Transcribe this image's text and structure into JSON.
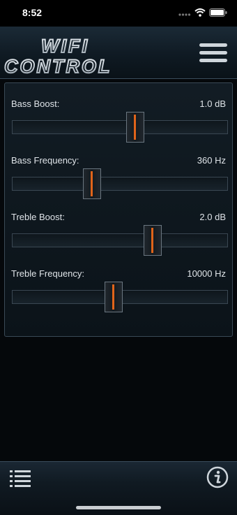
{
  "status_bar": {
    "time": "8:52"
  },
  "header": {
    "logo_line1": "WIFI",
    "logo_line2": "CONTROL",
    "menu_icon": "hamburger-menu-icon"
  },
  "sliders": [
    {
      "label": "Bass Boost:",
      "value": "1.0 dB",
      "level": 0.57
    },
    {
      "label": "Bass Frequency:",
      "value": "360 Hz",
      "level": 0.37
    },
    {
      "label": "Treble Boost:",
      "value": "2.0 dB",
      "level": 0.65
    },
    {
      "label": "Treble Frequency:",
      "value": "10000 Hz",
      "level": 0.47
    }
  ],
  "footer": {
    "left_icon": "list-icon",
    "right_icon": "info-icon"
  },
  "colors": {
    "accent": "#e0641a",
    "background": "#05080b"
  }
}
